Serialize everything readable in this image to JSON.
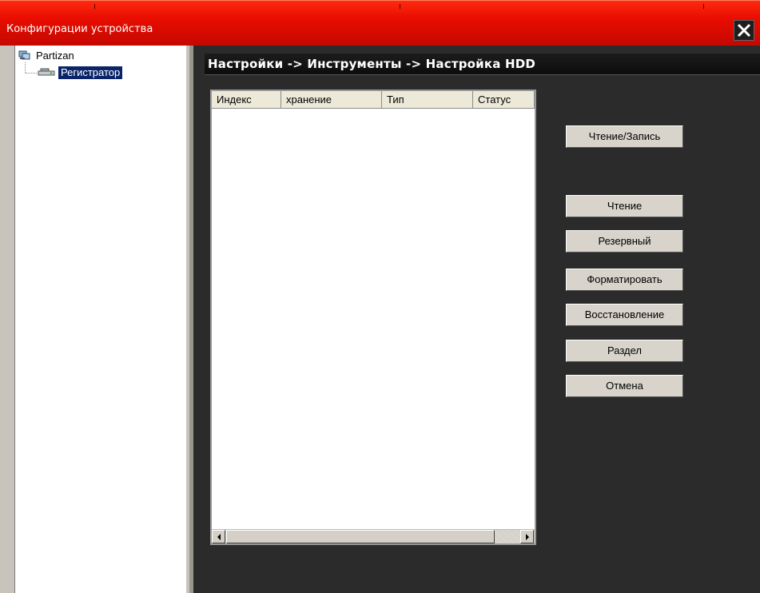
{
  "window": {
    "title": "Конфигурации устройства"
  },
  "tree": {
    "root_label": "Partizan",
    "child_label": "Регистратор"
  },
  "breadcrumb": "Настройки -> Инструменты -> Настройка HDD",
  "table": {
    "columns": [
      "Индекс",
      "хранение",
      "Тип",
      "Статус"
    ],
    "rows": []
  },
  "buttons": {
    "read_write": "Чтение/Запись",
    "read": "Чтение",
    "backup": "Резервный",
    "format": "Форматировать",
    "restore": "Восстановление",
    "partition": "Раздел",
    "cancel": "Отмена"
  },
  "colors": {
    "titlebar": "#e80d00",
    "background": "#2b2b2b",
    "selection": "#0a246a"
  }
}
